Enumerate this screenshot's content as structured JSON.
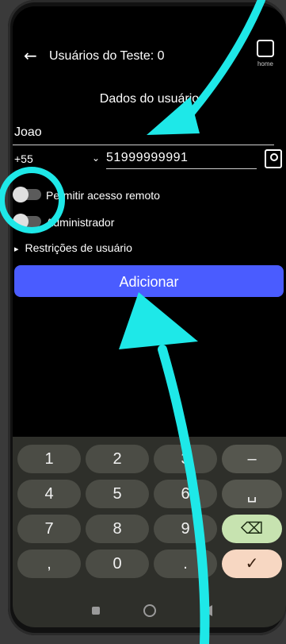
{
  "appbar": {
    "back_icon": "arrow-left-icon",
    "title": "Usuários do Teste: 0",
    "home_label": "home"
  },
  "form": {
    "section_title": "Dados do usuário",
    "name_value": "Joao",
    "country_code": "+55",
    "phone_value": "51999999991",
    "toggle_remote": "Permitir acesso remoto",
    "toggle_admin": "Administrador",
    "restrictions": "Restrições de usuário",
    "add_button": "Adicionar"
  },
  "keyboard": {
    "r1": [
      "1",
      "2",
      "3",
      "–"
    ],
    "r2": [
      "4",
      "5",
      "6",
      "␣"
    ],
    "r3": [
      "7",
      "8",
      "9",
      "⌫"
    ],
    "r4": [
      ",",
      "0",
      ".",
      "✓"
    ]
  },
  "colors": {
    "accent": "#4a5cff",
    "annotation": "#1ee8e8"
  }
}
